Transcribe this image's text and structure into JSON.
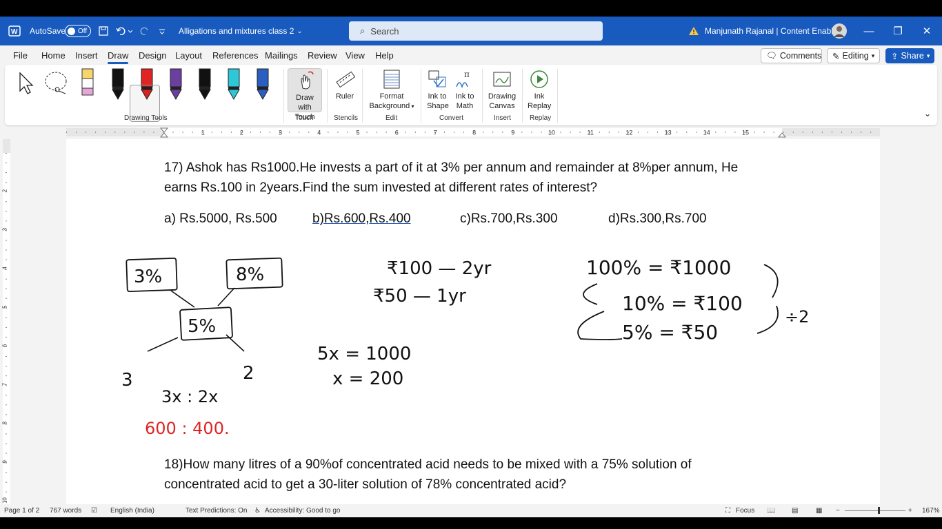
{
  "titlebar": {
    "autosave_label": "AutoSave",
    "autosave_state": "Off",
    "doc_title": "Alligations and mixtures class 2",
    "search_placeholder": "Search",
    "user_name": "Manjunath Rajanal | Content Enablers"
  },
  "menu": {
    "tabs": [
      "File",
      "Home",
      "Insert",
      "Draw",
      "Design",
      "Layout",
      "References",
      "Mailings",
      "Review",
      "View",
      "Help"
    ],
    "active_tab": "Draw",
    "comments_label": "Comments",
    "editing_label": "Editing",
    "share_label": "Share"
  },
  "ribbon": {
    "groups": {
      "drawing_tools": "Drawing Tools",
      "touch": "Touch",
      "stencils": "Stencils",
      "edit": "Edit",
      "convert": "Convert",
      "insert": "Insert",
      "replay": "Replay"
    },
    "buttons": {
      "draw_with_touch_1": "Draw with",
      "draw_with_touch_2": "Touch",
      "ruler": "Ruler",
      "format_bg_1": "Format",
      "format_bg_2": "Background",
      "ink_to_shape_1": "Ink to",
      "ink_to_shape_2": "Shape",
      "ink_to_math_1": "Ink to",
      "ink_to_math_2": "Math",
      "drawing_canvas_1": "Drawing",
      "drawing_canvas_2": "Canvas",
      "ink_replay_1": "Ink",
      "ink_replay_2": "Replay"
    },
    "pen_colors": [
      "#f7d56a",
      "#111111",
      "#e02424",
      "#6b3fa0",
      "#111111",
      "#2ec7d8",
      "#2a5fc1"
    ]
  },
  "ruler": {
    "ticks": [
      "1",
      "2",
      "3",
      "4",
      "5",
      "6",
      "7",
      "8",
      "9",
      "10",
      "11",
      "12",
      "13",
      "14",
      "15"
    ]
  },
  "vruler": {
    "ticks": [
      "2",
      "3",
      "4",
      "5",
      "6",
      "7",
      "8",
      "9",
      "10"
    ]
  },
  "document": {
    "q17_line1": "17) Ashok has Rs1000.He invests a part of it at 3% per annum and remainder at 8%per annum, He",
    "q17_line2": "earns Rs.100 in 2years.Find the sum invested at different rates of interest?",
    "options": [
      "a) Rs.5000, Rs.500",
      "b)Rs.600,Rs.400",
      "c)Rs.700,Rs.300",
      "d)Rs.300,Rs.700"
    ],
    "q18_line1": "18)How many litres of a 90%of concentrated acid needs to be mixed with a 75% solution of",
    "q18_line2": "concentrated acid to get a 30-liter solution of 78% concentrated acid?"
  },
  "ink": {
    "box1": "3%",
    "box2": "8%",
    "box3": "5%",
    "left_diff": "3",
    "right_diff": "2",
    "ratio": "3x : 2x",
    "ratio_values": "600 : 400.",
    "line1": "₹100 — 2yr",
    "line2": "₹50 — 1yr",
    "eq1": "5x = 1000",
    "eq2": "x = 200",
    "pct1": "100% = ₹1000",
    "pct2": "10% = ₹100",
    "pct3": "5% = ₹50",
    "div": "÷2",
    "ink_black": "#111111",
    "ink_red": "#e02424"
  },
  "status": {
    "page": "Page 1 of 2",
    "words": "767 words",
    "language": "English (India)",
    "predictions": "Text Predictions: On",
    "accessibility": "Accessibility: Good to go",
    "focus": "Focus",
    "zoom": "167%"
  }
}
